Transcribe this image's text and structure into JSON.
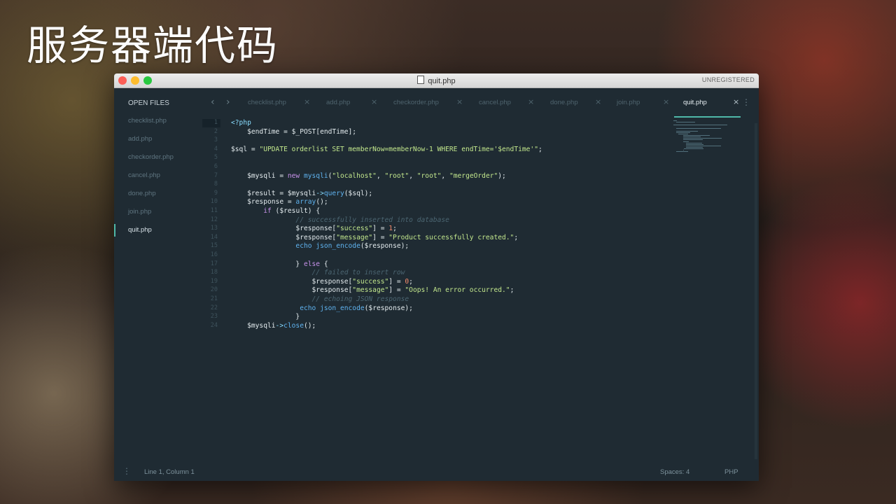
{
  "slide": {
    "title": "服务器端代码"
  },
  "window": {
    "title": "quit.php",
    "license": "UNREGISTERED"
  },
  "sidebar": {
    "header": "OPEN FILES",
    "items": [
      {
        "label": "checklist.php",
        "active": false
      },
      {
        "label": "add.php",
        "active": false
      },
      {
        "label": "checkorder.php",
        "active": false
      },
      {
        "label": "cancel.php",
        "active": false
      },
      {
        "label": "done.php",
        "active": false
      },
      {
        "label": "join.php",
        "active": false
      },
      {
        "label": "quit.php",
        "active": true
      }
    ]
  },
  "tabs": [
    {
      "label": "checklist.php",
      "active": false
    },
    {
      "label": "add.php",
      "active": false
    },
    {
      "label": "checkorder.php",
      "active": false
    },
    {
      "label": "cancel.php",
      "active": false
    },
    {
      "label": "done.php",
      "active": false
    },
    {
      "label": "join.php",
      "active": false
    },
    {
      "label": "quit.php",
      "active": true
    }
  ],
  "editor": {
    "line_numbers": [
      "1",
      "2",
      "3",
      "4",
      "5",
      "6",
      "7",
      "8",
      "9",
      "10",
      "11",
      "12",
      "13",
      "14",
      "15",
      "16",
      "17",
      "18",
      "19",
      "20",
      "21",
      "22",
      "23",
      "24"
    ],
    "lines": [
      "<?php",
      "    $endTime = $_POST[endTime];",
      "",
      "$sql = \"UPDATE orderlist SET memberNow=memberNow-1 WHERE endTime='$endTime'\";",
      "",
      "",
      "    $mysqli = new mysqli(\"localhost\", \"root\", \"root\", \"mergeOrder\");",
      "",
      "    $result = $mysqli->query($sql);",
      "    $response = array();",
      "        if ($result) {",
      "                // successfully inserted into database",
      "                $response[\"success\"] = 1;",
      "                $response[\"message\"] = \"Product successfully created.\";",
      "                echo json_encode($response);",
      "",
      "                } else {",
      "                    // failed to insert row",
      "                    $response[\"success\"] = 0;",
      "                    $response[\"message\"] = \"Oops! An error occurred.\";",
      "                    // echoing JSON response",
      "                 echo json_encode($response);",
      "                }",
      "    $mysqli->close();"
    ]
  },
  "status": {
    "position": "Line 1, Column 1",
    "indent": "Spaces: 4",
    "syntax": "PHP"
  },
  "colors": {
    "accent": "#4fb8a8",
    "editor_bg": "#1f2b33"
  }
}
